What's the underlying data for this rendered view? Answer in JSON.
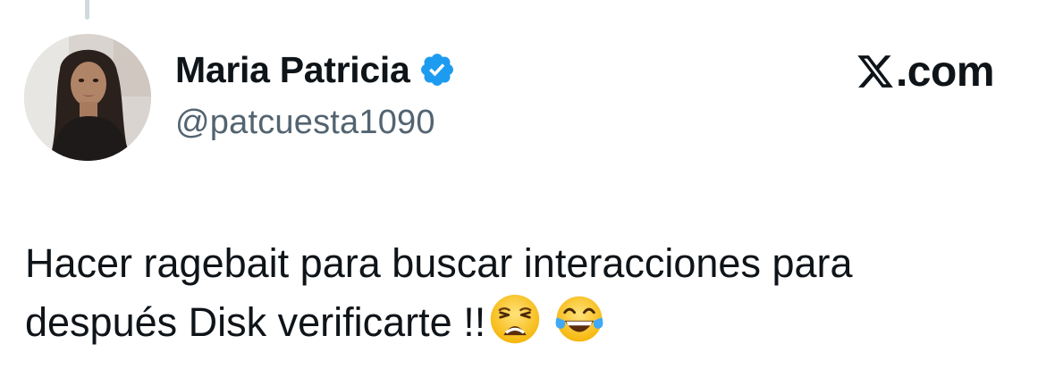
{
  "author": {
    "display_name": "Maria Patricia",
    "handle": "@patcuesta1090",
    "verified": true,
    "verified_color": "#1d9bf0"
  },
  "brand": {
    "label": ".com",
    "icon": "x-logo-icon"
  },
  "tweet": {
    "line1": "Hacer ragebait para buscar interacciones para",
    "line2": "después Disk verificarte !!",
    "emojis": [
      "weary-face-emoji",
      "tears-of-joy-emoji"
    ]
  },
  "colors": {
    "text_primary": "#0f1419",
    "text_secondary": "#536471",
    "thread_line": "#cfd9de"
  }
}
